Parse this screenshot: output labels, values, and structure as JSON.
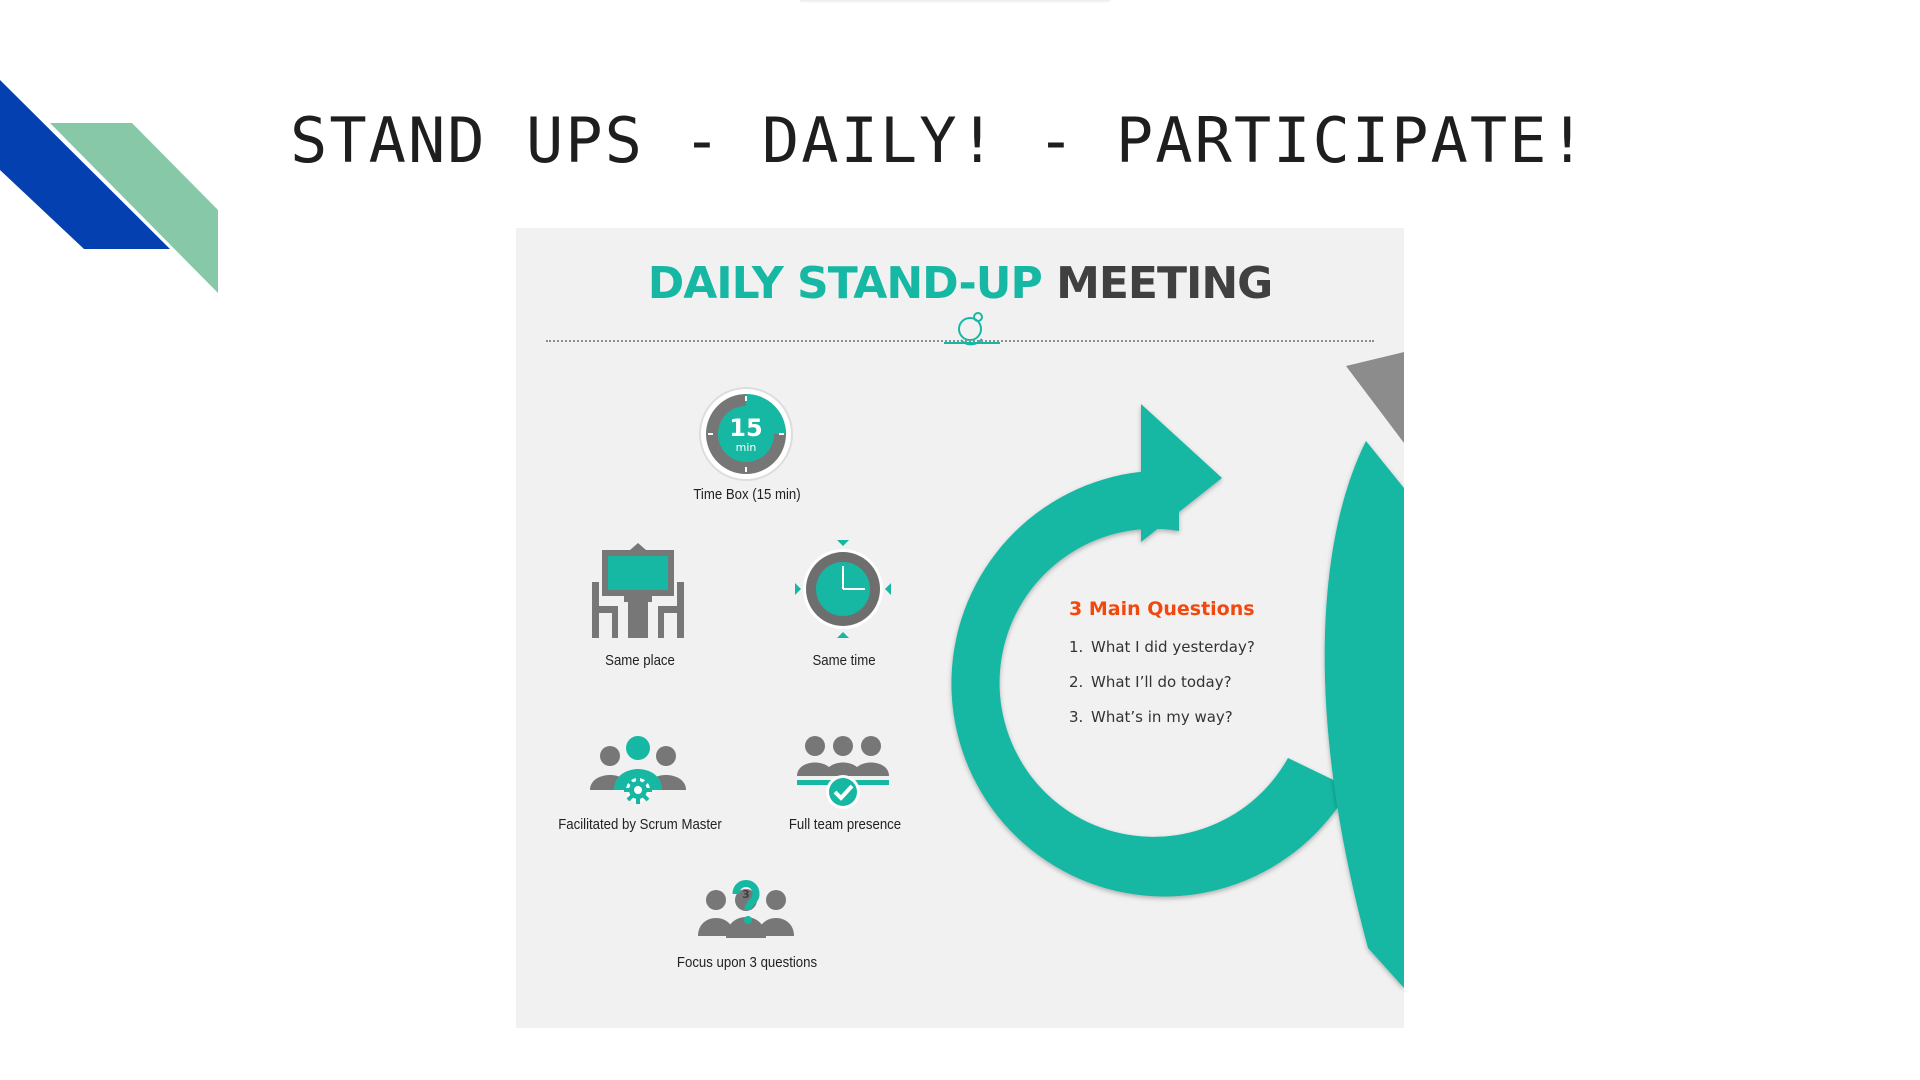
{
  "slide": {
    "title": "STAND UPS - DAILY! - PARTICIPATE!"
  },
  "infographic": {
    "title_accent": "DAILY STAND-UP",
    "title_rest": "MEETING",
    "timer_number": "15",
    "timer_unit": "min",
    "items": [
      {
        "label": "Time Box (15 min)",
        "icon": "timer-icon"
      },
      {
        "label": "Same place",
        "icon": "meeting-table-icon"
      },
      {
        "label": "Same time",
        "icon": "clock-icon"
      },
      {
        "label": "Facilitated by Scrum Master",
        "icon": "scrum-master-icon"
      },
      {
        "label": "Full team presence",
        "icon": "team-check-icon"
      },
      {
        "label": "Focus upon 3 questions",
        "icon": "team-question-icon"
      }
    ],
    "question_badge": "3",
    "questions_heading": "3 Main Questions",
    "questions": [
      {
        "num": "1.",
        "text": "What I did yesterday?"
      },
      {
        "num": "2.",
        "text": "What I’ll do today?"
      },
      {
        "num": "3.",
        "text": "What’s in my way?"
      }
    ]
  },
  "colors": {
    "teal": "#17b8a3",
    "dark_gray": "#404040",
    "orange": "#f2470d",
    "corner_blue": "#0440b0",
    "corner_green": "#86c8a7",
    "panel_bg": "#f1f1f1"
  }
}
